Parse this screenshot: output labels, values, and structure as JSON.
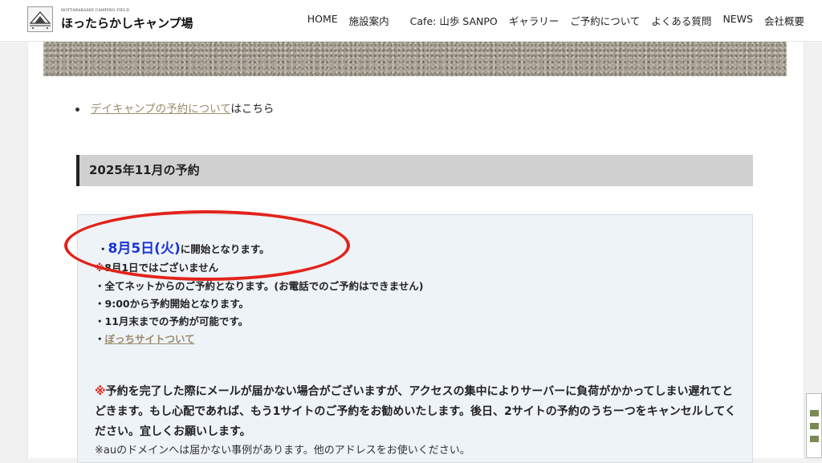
{
  "header": {
    "logo_sub": "HOTTARAKASHI CAMPING FIELD",
    "logo_title": "ほったらかしキャンプ場",
    "nav": [
      "HOME",
      "施設案内",
      "Cafe: 山歩 SANPO",
      "ギャラリー",
      "ご予約について",
      "よくある質問",
      "NEWS",
      "会社概要"
    ]
  },
  "day_camp": {
    "link": "デイキャンプの予約について",
    "suffix": "はこちら"
  },
  "section_heading": "2025年11月の予約",
  "info": {
    "open_bullet": "・",
    "open_date": "8月5日(火)",
    "open_rest": "に開始となります。",
    "line1_mark": "※",
    "line1": "8月1日ではございません",
    "line2": "・全てネットからのご予約となります。(お電話でのご予約はできません)",
    "line3": "・9:00から予約開始となります。",
    "line4": "・11月末までの予約が可能です。",
    "line5_prefix": "・",
    "line5_link": "ぼっちサイトついて",
    "para_mark": "※",
    "para": "予約を完了した際にメールが届かない場合がございますが、アクセスの集中によりサーバーに負荷がかかってしまい遅れてとどきます。もし心配であれば、もう1サイトのご予約をお勧めいたします。後日、2サイトの予約のうちーつをキャンセルしてください。宜しくお願いします。",
    "note": "※auのドメインへは届かない事例があります。他のアドレスをお使いください。"
  },
  "colors": {
    "accent_date": "#1a33d6",
    "annotation_red": "#e2231a",
    "link": "#9a8b6b"
  }
}
